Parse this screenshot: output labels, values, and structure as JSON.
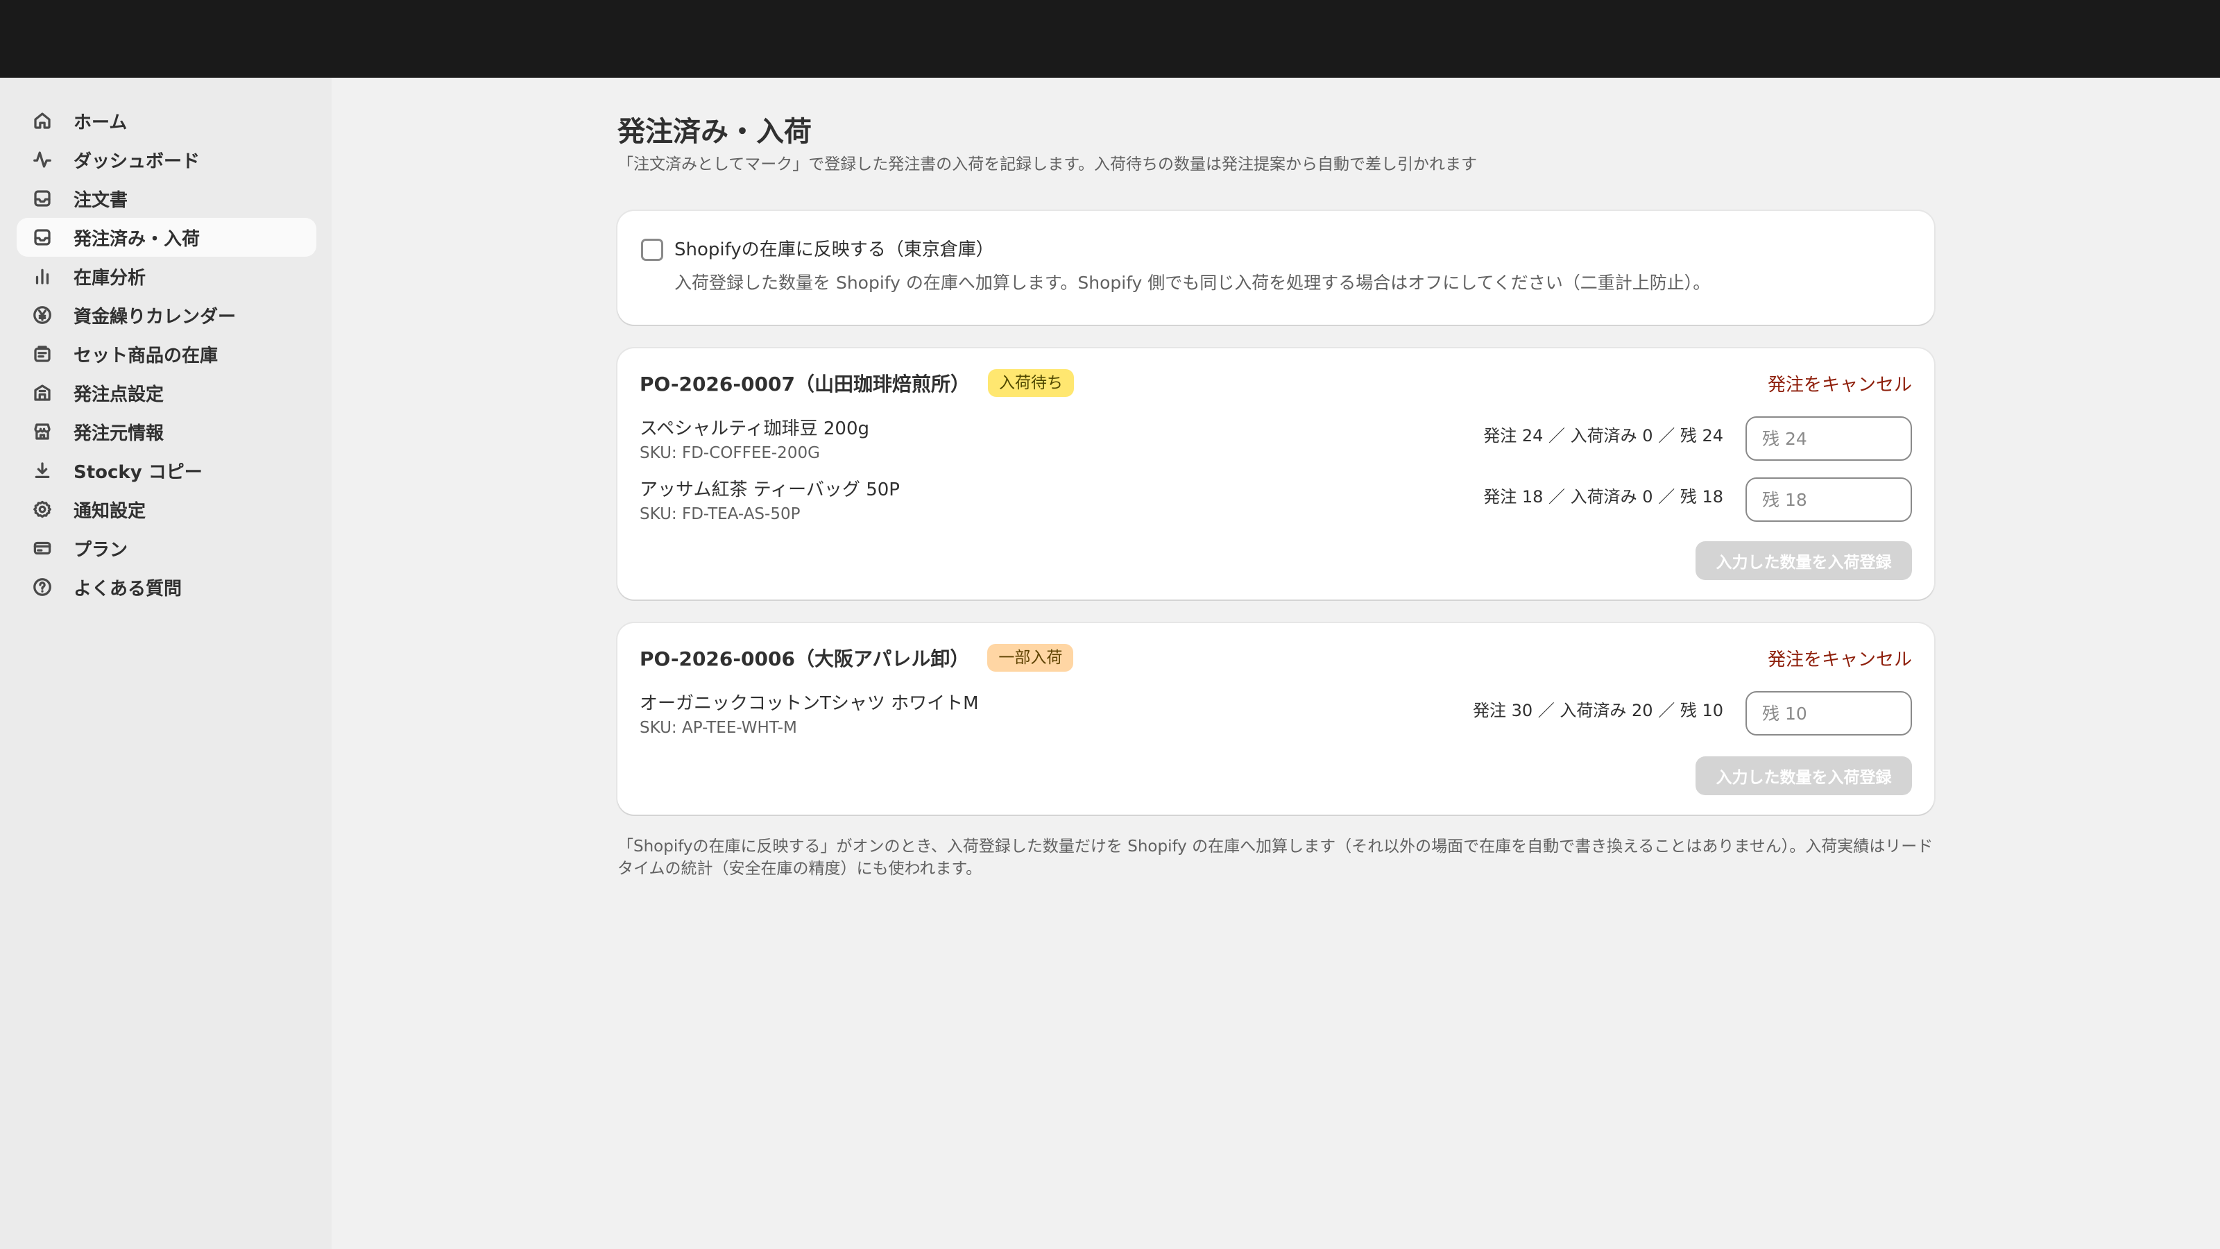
{
  "sidebar": {
    "items": [
      {
        "label": "ホーム",
        "icon": "home-icon"
      },
      {
        "label": "ダッシュボード",
        "icon": "pulse-icon"
      },
      {
        "label": "注文書",
        "icon": "inbox-icon"
      },
      {
        "label": "発注済み・入荷",
        "icon": "inbox-icon",
        "active": true
      },
      {
        "label": "在庫分析",
        "icon": "bar-chart-icon"
      },
      {
        "label": "資金繰りカレンダー",
        "icon": "yen-icon"
      },
      {
        "label": "セット商品の在庫",
        "icon": "bundle-icon"
      },
      {
        "label": "発注点設定",
        "icon": "building-icon"
      },
      {
        "label": "発注元情報",
        "icon": "store-icon"
      },
      {
        "label": "Stocky コピー",
        "icon": "download-icon"
      },
      {
        "label": "通知設定",
        "icon": "gear-icon"
      },
      {
        "label": "プラン",
        "icon": "credit-card-icon"
      },
      {
        "label": "よくある質問",
        "icon": "question-icon"
      }
    ]
  },
  "header": {
    "title": "発注済み・入荷",
    "subtitle": "「注文済みとしてマーク」で登録した発注書の入荷を記録します。入荷待ちの数量は発注提案から自動で差し引かれます"
  },
  "sync": {
    "label": "Shopifyの在庫に反映する（東京倉庫）",
    "description": "入荷登録した数量を Shopify の在庫へ加算します。Shopify 側でも同じ入荷を処理する場合はオフにしてください（二重計上防止）。",
    "checked": false
  },
  "orders": [
    {
      "title": "PO-2026-0007（山田珈琲焙煎所）",
      "status": "入荷待ち",
      "cancel_label": "発注をキャンセル",
      "lines": [
        {
          "name": "スペシャルティ珈琲豆 200g",
          "sku": "SKU: FD-COFFEE-200G",
          "qty": "発注 24 ／ 入荷済み 0 ／ 残 24",
          "placeholder": "残 24"
        },
        {
          "name": "アッサム紅茶 ティーバッグ 50P",
          "sku": "SKU: FD-TEA-AS-50P",
          "qty": "発注 18 ／ 入荷済み 0 ／ 残 18",
          "placeholder": "残 18"
        }
      ],
      "submit_label": "入力した数量を入荷登録"
    },
    {
      "title": "PO-2026-0006（大阪アパレル卸）",
      "status": "一部入荷",
      "cancel_label": "発注をキャンセル",
      "lines": [
        {
          "name": "オーガニックコットンTシャツ ホワイトM",
          "sku": "SKU: AP-TEE-WHT-M",
          "qty": "発注 30 ／ 入荷済み 20 ／ 残 10",
          "placeholder": "残 10"
        }
      ],
      "submit_label": "入力した数量を入荷登録"
    }
  ],
  "footnote": "「Shopifyの在庫に反映する」がオンのとき、入荷登録した数量だけを Shopify の在庫へ加算します（それ以外の場面で在庫を自動で書き換えることはありません）。入荷実績はリードタイムの統計（安全在庫の精度）にも使われます。",
  "colors": {
    "topbar": "#1a1a1a",
    "cancel": "#8e1f0b",
    "badge_waiting": "#ffe770",
    "badge_partial": "#ffd6a4"
  }
}
